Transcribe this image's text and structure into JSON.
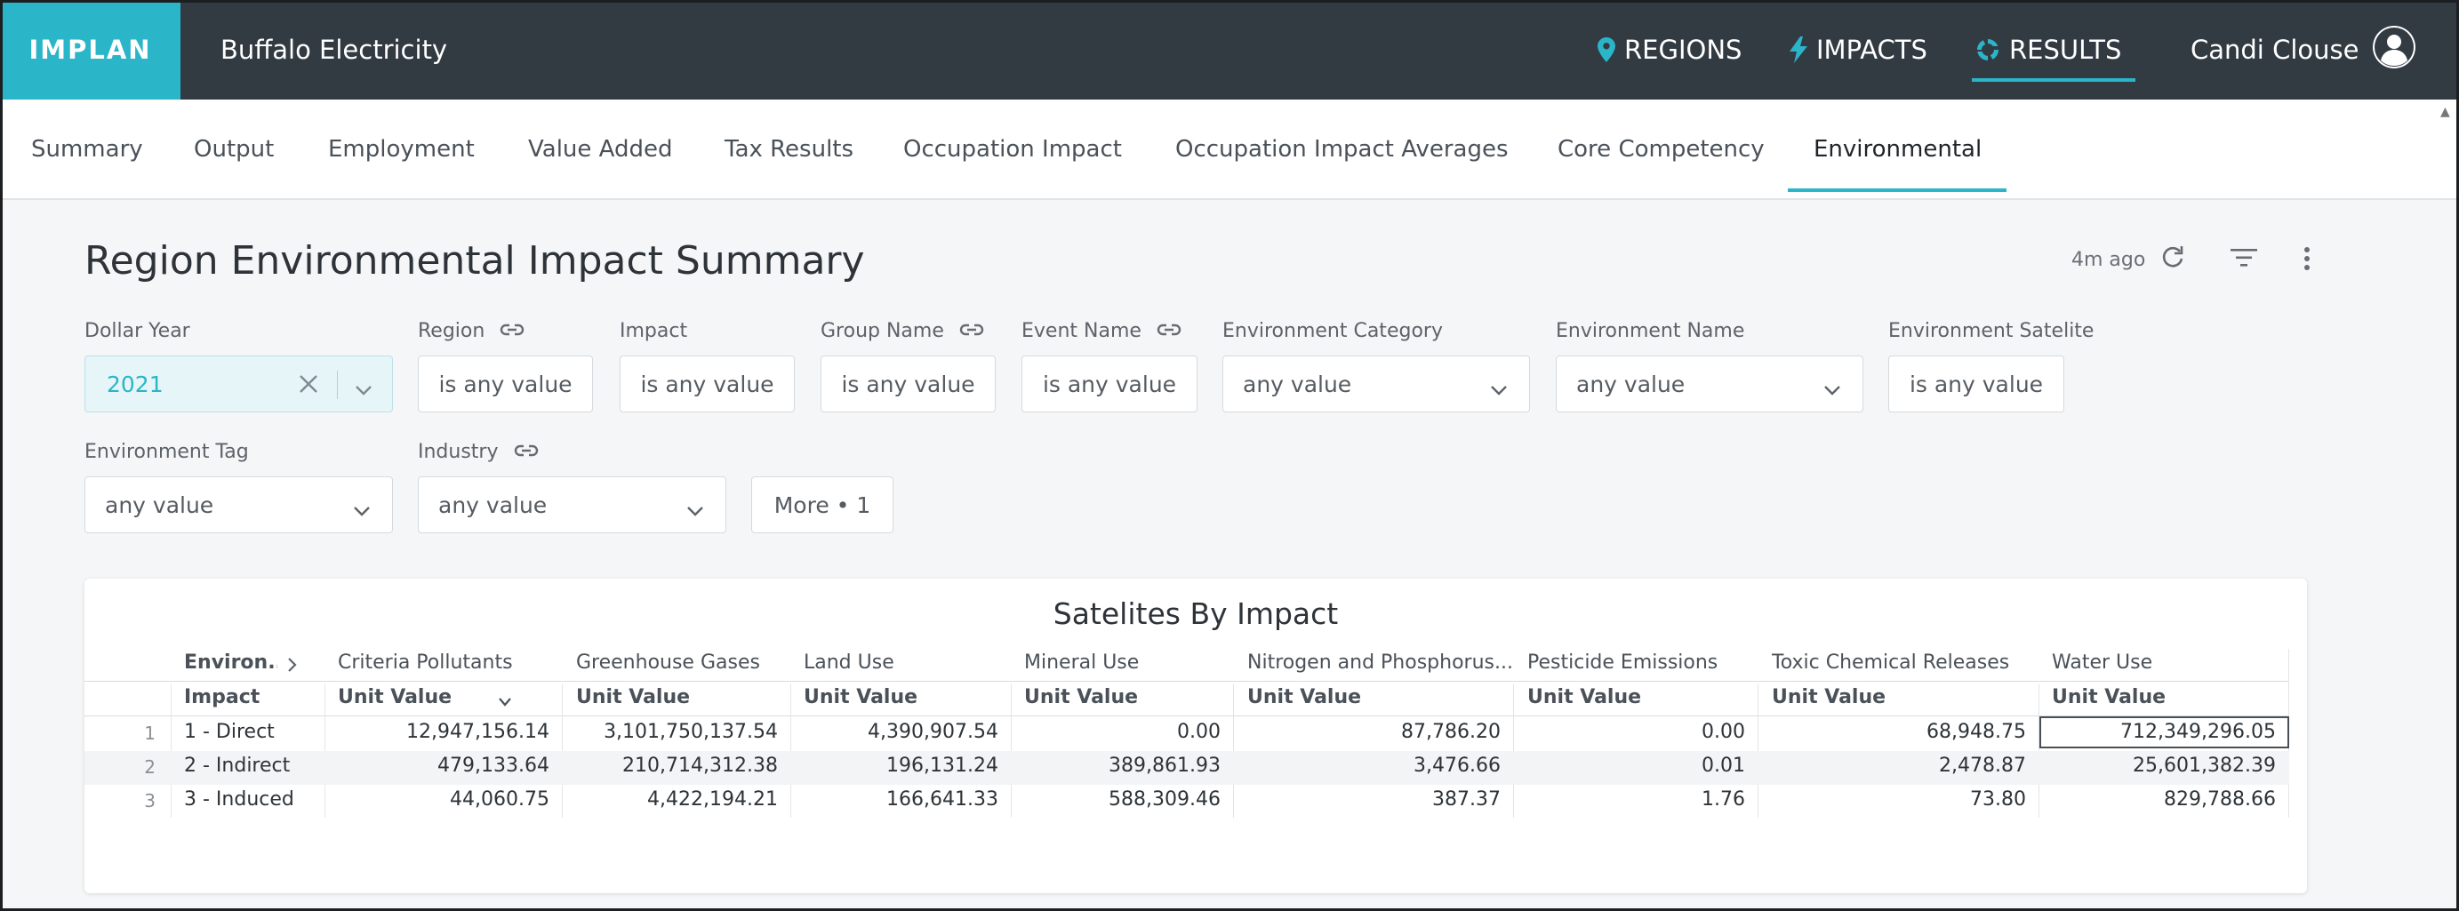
{
  "app": {
    "logo": "IMPLAN",
    "project_title": "Buffalo Electricity",
    "nav": [
      {
        "label": "REGIONS",
        "icon": "map-pin-icon"
      },
      {
        "label": "IMPACTS",
        "icon": "lightning-icon"
      },
      {
        "label": "RESULTS",
        "icon": "results-cycle-icon",
        "active": true
      }
    ],
    "user_name": "Candi Clouse",
    "accent": "#2bb5c9",
    "topbar_color": "#323a42"
  },
  "tabs": [
    {
      "label": "Summary"
    },
    {
      "label": "Output"
    },
    {
      "label": "Employment"
    },
    {
      "label": "Value Added"
    },
    {
      "label": "Tax Results"
    },
    {
      "label": "Occupation Impact"
    },
    {
      "label": "Occupation Impact Averages"
    },
    {
      "label": "Core Competency"
    },
    {
      "label": "Environmental",
      "active": true
    }
  ],
  "header": {
    "title": "Region Environmental Impact Summary",
    "updated": "4m ago"
  },
  "filters": {
    "dollar_year": {
      "label": "Dollar Year",
      "value": "2021"
    },
    "region": {
      "label": "Region",
      "value": "is any value"
    },
    "impact": {
      "label": "Impact",
      "value": "is any value"
    },
    "group_name": {
      "label": "Group Name",
      "value": "is any value"
    },
    "event_name": {
      "label": "Event Name",
      "value": "is any value"
    },
    "environment_category": {
      "label": "Environment Category",
      "value": "any value"
    },
    "environment_name": {
      "label": "Environment Name",
      "value": "any value"
    },
    "environment_satelite": {
      "label": "Environment Satelite",
      "value": "is any value"
    },
    "environment_tag": {
      "label": "Environment Tag",
      "value": "any value"
    },
    "industry": {
      "label": "Industry",
      "value": "any value"
    },
    "more": "More • 1"
  },
  "table": {
    "title": "Satelites By Impact",
    "pivot_header": "Environ...",
    "row_header": "Impact",
    "columns": [
      "Criteria Pollutants",
      "Greenhouse Gases",
      "Land Use",
      "Mineral Use",
      "Nitrogen and Phosphorus...",
      "Pesticide Emissions",
      "Toxic Chemical Releases",
      "Water Use"
    ],
    "measure": "Unit Value",
    "rows": [
      {
        "num": "1",
        "impact": "1 - Direct",
        "values": [
          "12,947,156.14",
          "3,101,750,137.54",
          "4,390,907.54",
          "0.00",
          "87,786.20",
          "0.00",
          "68,948.75",
          "712,349,296.05"
        ]
      },
      {
        "num": "2",
        "impact": "2 - Indirect",
        "values": [
          "479,133.64",
          "210,714,312.38",
          "196,131.24",
          "389,861.93",
          "3,476.66",
          "0.01",
          "2,478.87",
          "25,601,382.39"
        ]
      },
      {
        "num": "3",
        "impact": "3 - Induced",
        "values": [
          "44,060.75",
          "4,422,194.21",
          "166,641.33",
          "588,309.46",
          "387.37",
          "1.76",
          "73.80",
          "829,788.66"
        ]
      }
    ]
  }
}
